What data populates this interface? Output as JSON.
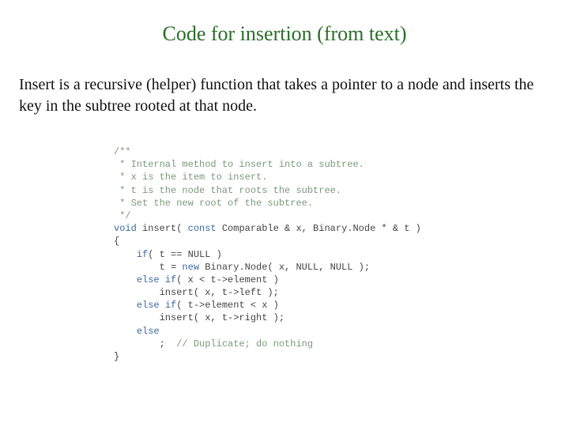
{
  "title": "Code for insertion (from text)",
  "description": "Insert is a recursive (helper) function that takes a pointer to a node and inserts the key in the subtree rooted at that node.",
  "code": {
    "c1": "/**",
    "c2": " * Internal method to insert into a subtree.",
    "c3": " * x is the item to insert.",
    "c4": " * t is the node that roots the subtree.",
    "c5": " * Set the new root of the subtree.",
    "c6": " */",
    "kw_void": "void",
    "fn_name": " insert( ",
    "kw_const": "const",
    "ty_comp": " Comparable & x, Binary.Node * & t )",
    "lbrace": "{",
    "kw_if1": "if",
    "if1_cond": "( t == NULL )",
    "stmt1a": "        t = ",
    "kw_new": "new",
    "stmt1b": " Binary.Node( x, NULL, NULL );",
    "kw_elseif1": "else if",
    "eif1_cond": "( x < t->element )",
    "stmt2": "        insert( x, t->left );",
    "kw_elseif2": "else if",
    "eif2_cond": "( t->element < x )",
    "stmt3": "        insert( x, t->right );",
    "kw_else": "else",
    "stmt4a": "        ;  ",
    "stmt4b": "// Duplicate; do nothing",
    "rbrace": "}"
  }
}
